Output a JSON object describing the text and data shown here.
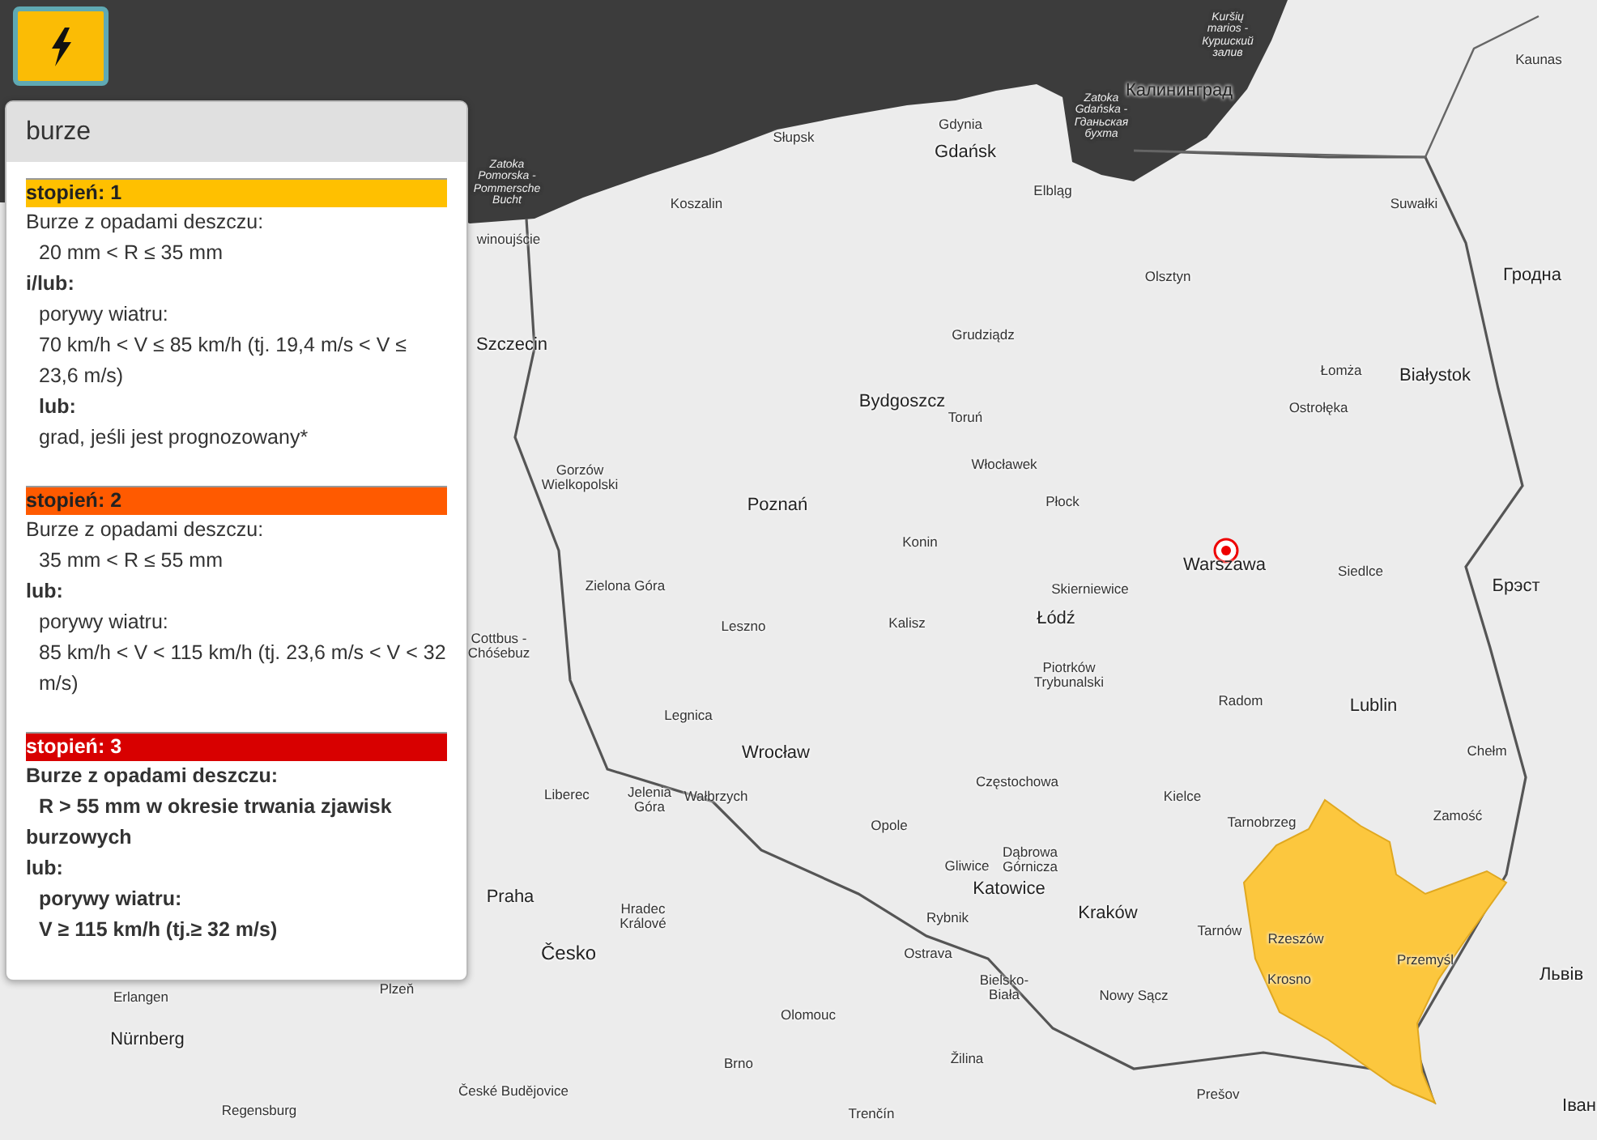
{
  "warning_button": {
    "selected": true
  },
  "popup": {
    "title": "burze",
    "levels": [
      {
        "label": "stopień: 1",
        "color": "#ffc000",
        "emphasis": false,
        "lines": [
          {
            "kind": "text",
            "text": "Burze z opadami deszczu:"
          },
          {
            "kind": "detail",
            "text": "20 mm < R ≤ 35 mm"
          },
          {
            "kind": "connector",
            "text": "i/lub:"
          },
          {
            "kind": "detail",
            "text": "porywy wiatru:"
          },
          {
            "kind": "detail",
            "text": "70 km/h < V ≤ 85 km/h (tj. 19,4 m/s < V ≤ 23,6 m/s)"
          },
          {
            "kind": "connector_detail",
            "text": "lub:"
          },
          {
            "kind": "detail",
            "text": "grad, jeśli jest prognozowany*"
          }
        ]
      },
      {
        "label": "stopień: 2",
        "color": "#ff5a00",
        "emphasis": false,
        "lines": [
          {
            "kind": "text",
            "text": "Burze z opadami deszczu:"
          },
          {
            "kind": "detail",
            "text": "35 mm < R ≤ 55 mm"
          },
          {
            "kind": "connector",
            "text": "lub:"
          },
          {
            "kind": "detail",
            "text": "porywy wiatru:"
          },
          {
            "kind": "detail",
            "text": "85 km/h < V < 115 km/h (tj. 23,6 m/s < V < 32 m/s)"
          }
        ]
      },
      {
        "label": "stopień: 3",
        "color": "#d80000",
        "emphasis": true,
        "lines": [
          {
            "kind": "text",
            "text": "Burze z opadami deszczu:"
          },
          {
            "kind": "detail",
            "text": "R > 55 mm w okresie trwania zjawisk burzowych"
          },
          {
            "kind": "connector",
            "text": "lub:"
          },
          {
            "kind": "detail",
            "text": "porywy wiatru:"
          },
          {
            "kind": "detail",
            "text": "V ≥ 115 km/h (tj.≥ 32 m/s)"
          }
        ]
      }
    ]
  },
  "map": {
    "warning_area": {
      "color": "#fcc73e"
    },
    "labels": [
      {
        "text": "Kuršių marios - Куршский залив",
        "kind": "water"
      },
      {
        "text": "Zatoka Gdańska - Гданьская бухта",
        "kind": "water"
      },
      {
        "text": "Zatoka Pomorska - Pommersche Bucht",
        "kind": "water"
      },
      {
        "text": "Kaunas",
        "kind": "small"
      },
      {
        "text": "Калининград",
        "kind": "large"
      },
      {
        "text": "Gdynia",
        "kind": "small"
      },
      {
        "text": "Gdańsk",
        "kind": "large"
      },
      {
        "text": "Słupsk",
        "kind": "small"
      },
      {
        "text": "Elbląg",
        "kind": "small"
      },
      {
        "text": "Koszalin",
        "kind": "small"
      },
      {
        "text": "winoujście",
        "kind": "small"
      },
      {
        "text": "Suwałki",
        "kind": "small"
      },
      {
        "text": "Гродна",
        "kind": "large"
      },
      {
        "text": "Olsztyn",
        "kind": "small"
      },
      {
        "text": "Grudziądz",
        "kind": "small"
      },
      {
        "text": "Szczecin",
        "kind": "large"
      },
      {
        "text": "Łomża",
        "kind": "small"
      },
      {
        "text": "Białystok",
        "kind": "large"
      },
      {
        "text": "Bydgoszcz",
        "kind": "large"
      },
      {
        "text": "Toruń",
        "kind": "small"
      },
      {
        "text": "Ostrołęka",
        "kind": "small"
      },
      {
        "text": "Gorzów Wielkopolski",
        "kind": "small"
      },
      {
        "text": "Włocławek",
        "kind": "small"
      },
      {
        "text": "Poznań",
        "kind": "large"
      },
      {
        "text": "Płock",
        "kind": "small"
      },
      {
        "text": "Konin",
        "kind": "small"
      },
      {
        "text": "Zielona Góra",
        "kind": "small"
      },
      {
        "text": "Skierniewice",
        "kind": "small"
      },
      {
        "text": "Warszawa",
        "kind": "large"
      },
      {
        "text": "Siedlce",
        "kind": "small"
      },
      {
        "text": "Брэст",
        "kind": "large"
      },
      {
        "text": "Leszno",
        "kind": "small"
      },
      {
        "text": "Kalisz",
        "kind": "small"
      },
      {
        "text": "Łódź",
        "kind": "large"
      },
      {
        "text": "Cottbus - Chóśebuz",
        "kind": "small"
      },
      {
        "text": "Piotrków Trybunalski",
        "kind": "small"
      },
      {
        "text": "Radom",
        "kind": "small"
      },
      {
        "text": "Lublin",
        "kind": "large"
      },
      {
        "text": "Legnica",
        "kind": "small"
      },
      {
        "text": "Wrocław",
        "kind": "large"
      },
      {
        "text": "Chełm",
        "kind": "small"
      },
      {
        "text": "Liberec",
        "kind": "small"
      },
      {
        "text": "Jelenia Góra",
        "kind": "small"
      },
      {
        "text": "Wałbrzych",
        "kind": "small"
      },
      {
        "text": "Częstochowa",
        "kind": "small"
      },
      {
        "text": "Kielce",
        "kind": "small"
      },
      {
        "text": "Tarnobrzeg",
        "kind": "small"
      },
      {
        "text": "Zamość",
        "kind": "small"
      },
      {
        "text": "Opole",
        "kind": "small"
      },
      {
        "text": "Gliwice",
        "kind": "small"
      },
      {
        "text": "Dąbrowa Górnicza",
        "kind": "small"
      },
      {
        "text": "Katowice",
        "kind": "large"
      },
      {
        "text": "Kraków",
        "kind": "large"
      },
      {
        "text": "Praha",
        "kind": "large"
      },
      {
        "text": "Hradec Králové",
        "kind": "small"
      },
      {
        "text": "Rybnik",
        "kind": "small"
      },
      {
        "text": "Česko",
        "kind": "country"
      },
      {
        "text": "Tarnów",
        "kind": "small"
      },
      {
        "text": "Rzeszów",
        "kind": "small"
      },
      {
        "text": "Ostrava",
        "kind": "small"
      },
      {
        "text": "Przemyśl",
        "kind": "small"
      },
      {
        "text": "Bielsko-Biała",
        "kind": "small"
      },
      {
        "text": "Krosno",
        "kind": "small"
      },
      {
        "text": "Olomouc",
        "kind": "small"
      },
      {
        "text": "Nowy Sącz",
        "kind": "small"
      },
      {
        "text": "Львів",
        "kind": "large"
      },
      {
        "text": "Plzeň",
        "kind": "small"
      },
      {
        "text": "Erlangen",
        "kind": "small"
      },
      {
        "text": "Nürnberg",
        "kind": "large"
      },
      {
        "text": "Brno",
        "kind": "small"
      },
      {
        "text": "Žilina",
        "kind": "small"
      },
      {
        "text": "České Budějovice",
        "kind": "small"
      },
      {
        "text": "Prešov",
        "kind": "small"
      },
      {
        "text": "Regensburg",
        "kind": "small"
      },
      {
        "text": "Trenčín",
        "kind": "small"
      },
      {
        "text": "Іван",
        "kind": "large"
      }
    ]
  }
}
